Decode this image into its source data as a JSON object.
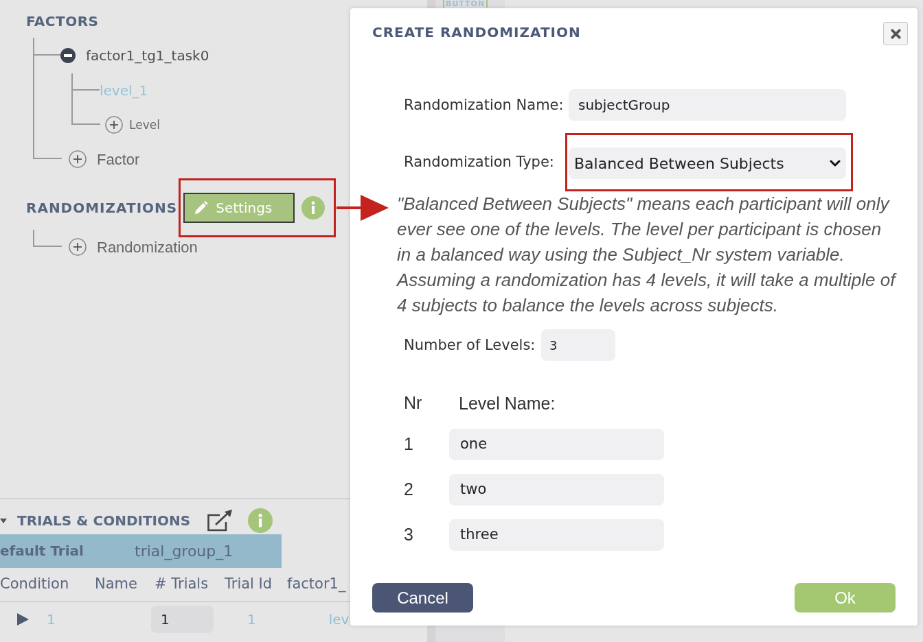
{
  "top_tag": "BUTTON",
  "factors": {
    "title": "FACTORS",
    "tree": [
      {
        "label": "factor1_tg1_task0",
        "kind": "factor",
        "expanded": true,
        "children": [
          {
            "label": "level_1",
            "kind": "level"
          },
          {
            "label": "Level",
            "kind": "add"
          }
        ]
      },
      {
        "label": "Factor",
        "kind": "add"
      }
    ]
  },
  "randomizations": {
    "title": "RANDOMIZATIONS",
    "settings_button": {
      "label": "Settings",
      "highlighted": true
    },
    "tree": [
      {
        "label": "Randomization",
        "kind": "add"
      }
    ]
  },
  "trials": {
    "title": "TRIALS & CONDITIONS",
    "expanded": true,
    "group_row": {
      "name": "efault Trial",
      "group": "trial_group_1"
    },
    "columns": [
      "Condition",
      "Name",
      "# Trials",
      "Trial Id",
      "factor1_"
    ],
    "rows": [
      {
        "expanded": false,
        "condition": "1",
        "trials": "1",
        "trial_id": "1",
        "column_5": "lev"
      }
    ]
  },
  "dialog": {
    "title": "CREATE RANDOMIZATION",
    "name_field": {
      "label": "Randomization Name:",
      "value": "subjectGroup"
    },
    "type_field": {
      "label": "Randomization Type:",
      "value": "Balanced Between Subjects",
      "highlighted": true
    },
    "description": "\"Balanced Between Subjects\" means each participant will only ever see one of the levels. The level per participant is chosen in a balanced way using the Subject_Nr system variable. Assuming a randomization has 4 levels, it will take a multiple of 4 subjects to balance the levels across subjects.",
    "levels_field": {
      "label": "Number of Levels:",
      "value": "3"
    },
    "level_columns": [
      "Nr",
      "Level Name:"
    ],
    "levels": [
      {
        "nr": "1",
        "name": "one"
      },
      {
        "nr": "2",
        "name": "two"
      },
      {
        "nr": "3",
        "name": "three"
      }
    ],
    "buttons": [
      {
        "label": "Cancel",
        "kind": "secondary"
      },
      {
        "label": "Ok",
        "kind": "primary"
      }
    ]
  }
}
